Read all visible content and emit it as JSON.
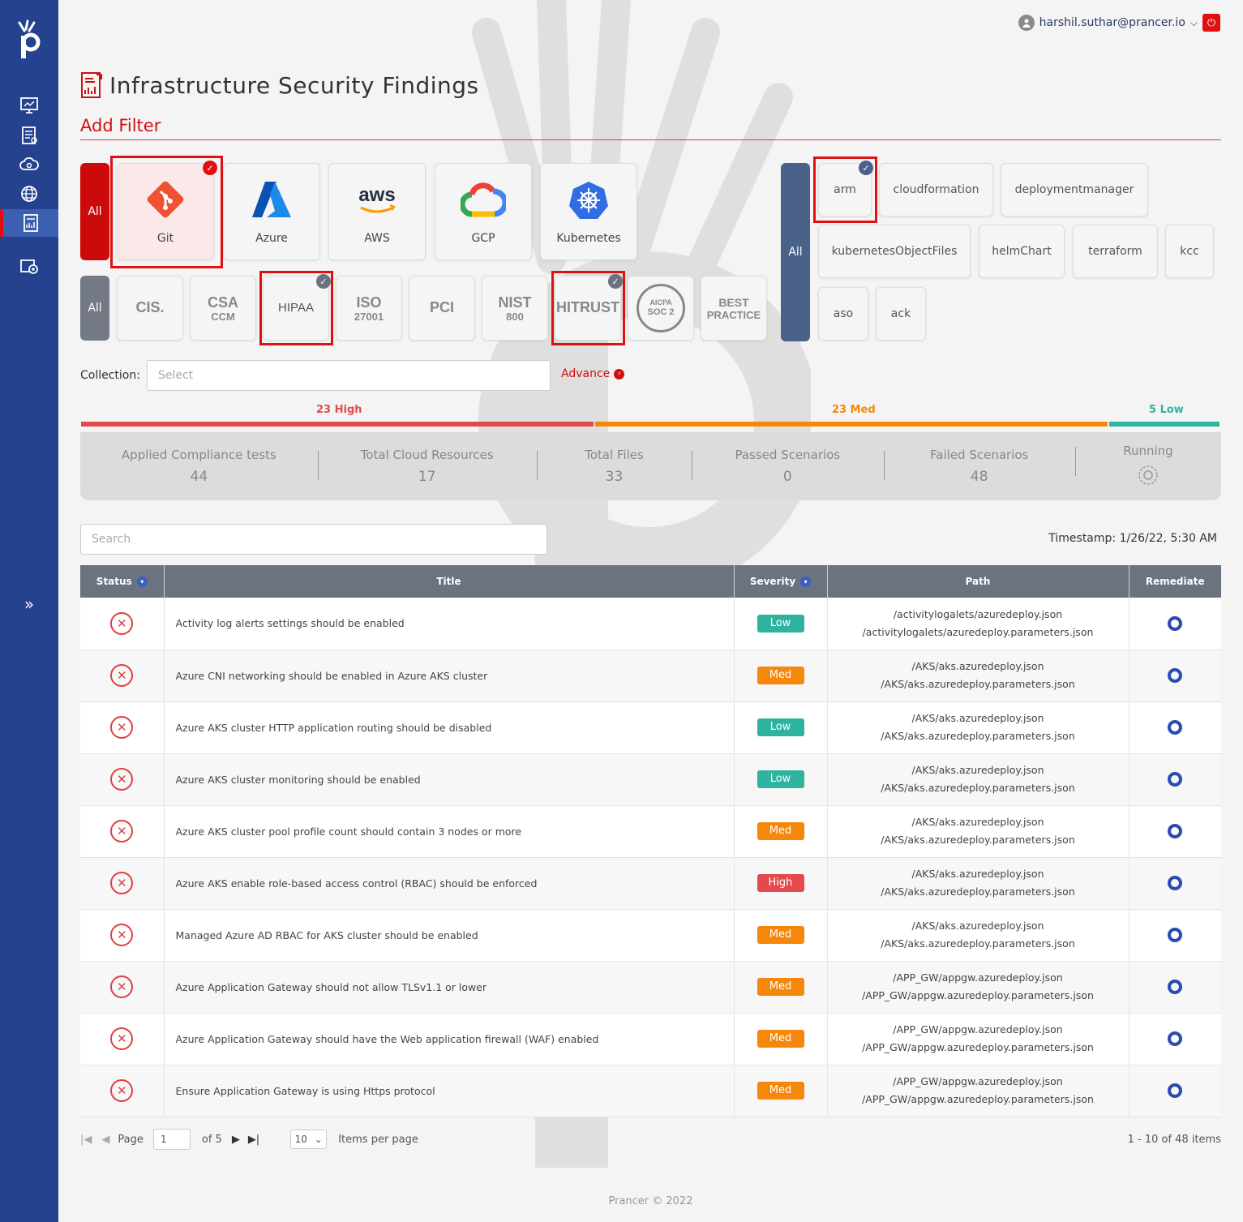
{
  "user": {
    "email": "harshil.suthar@prancer.io"
  },
  "page": {
    "title": "Infrastructure Security Findings",
    "add_filter": "Add Filter"
  },
  "filters": {
    "all_label": "All",
    "providers": [
      "Git",
      "Azure",
      "AWS",
      "GCP",
      "Kubernetes"
    ],
    "compliance": [
      {
        "name": "cis",
        "line1": "CIS.",
        "line2": ""
      },
      {
        "name": "csa-ccm",
        "line1": "CSA",
        "line2": "CCM"
      },
      {
        "name": "hipaa",
        "line1": "HIPAA",
        "line2": ""
      },
      {
        "name": "iso",
        "line1": "ISO",
        "line2": "27001"
      },
      {
        "name": "pci",
        "line1": "PCI",
        "line2": ""
      },
      {
        "name": "nist",
        "line1": "NIST",
        "line2": "800"
      },
      {
        "name": "hitrust",
        "line1": "HITRUST",
        "line2": ""
      },
      {
        "name": "soc2",
        "line1": "AICPA",
        "line2": "SOC 2"
      },
      {
        "name": "best-practice",
        "line1": "BEST",
        "line2": "PRACTICE"
      }
    ],
    "templates": [
      "arm",
      "cloudformation",
      "deploymentmanager",
      "kubernetesObjectFiles",
      "helmChart",
      "terraform",
      "kcc",
      "aso",
      "ack"
    ]
  },
  "collection": {
    "label": "Collection:",
    "placeholder": "Select"
  },
  "advance": "Advance",
  "severity": {
    "high": "23 High",
    "med": "23 Med",
    "low": "5 Low",
    "high_count": 23,
    "med_count": 23,
    "low_count": 5
  },
  "stats": [
    {
      "label": "Applied Compliance tests",
      "value": "44"
    },
    {
      "label": "Total Cloud Resources",
      "value": "17"
    },
    {
      "label": "Total Files",
      "value": "33"
    },
    {
      "label": "Passed Scenarios",
      "value": "0"
    },
    {
      "label": "Failed Scenarios",
      "value": "48"
    },
    {
      "label": "Running",
      "value": ""
    }
  ],
  "search": {
    "placeholder": "Search"
  },
  "timestamp": "Timestamp: 1/26/22, 5:30 AM",
  "table": {
    "headers": {
      "status": "Status",
      "title": "Title",
      "severity": "Severity",
      "path": "Path",
      "remediate": "Remediate"
    },
    "rows": [
      {
        "title": "Activity log alerts settings should be enabled",
        "severity": "Low",
        "path1": "/activitylogalets/azuredeploy.json",
        "path2": "/activitylogalets/azuredeploy.parameters.json"
      },
      {
        "title": "Azure CNI networking should be enabled in Azure AKS cluster",
        "severity": "Med",
        "path1": "/AKS/aks.azuredeploy.json",
        "path2": "/AKS/aks.azuredeploy.parameters.json"
      },
      {
        "title": "Azure AKS cluster HTTP application routing should be disabled",
        "severity": "Low",
        "path1": "/AKS/aks.azuredeploy.json",
        "path2": "/AKS/aks.azuredeploy.parameters.json"
      },
      {
        "title": "Azure AKS cluster monitoring should be enabled",
        "severity": "Low",
        "path1": "/AKS/aks.azuredeploy.json",
        "path2": "/AKS/aks.azuredeploy.parameters.json"
      },
      {
        "title": "Azure AKS cluster pool profile count should contain 3 nodes or more",
        "severity": "Med",
        "path1": "/AKS/aks.azuredeploy.json",
        "path2": "/AKS/aks.azuredeploy.parameters.json"
      },
      {
        "title": "Azure AKS enable role-based access control (RBAC) should be enforced",
        "severity": "High",
        "path1": "/AKS/aks.azuredeploy.json",
        "path2": "/AKS/aks.azuredeploy.parameters.json"
      },
      {
        "title": "Managed Azure AD RBAC for AKS cluster should be enabled",
        "severity": "Med",
        "path1": "/AKS/aks.azuredeploy.json",
        "path2": "/AKS/aks.azuredeploy.parameters.json"
      },
      {
        "title": "Azure Application Gateway should not allow TLSv1.1 or lower",
        "severity": "Med",
        "path1": "/APP_GW/appgw.azuredeploy.json",
        "path2": "/APP_GW/appgw.azuredeploy.parameters.json"
      },
      {
        "title": "Azure Application Gateway should have the Web application firewall (WAF) enabled",
        "severity": "Med",
        "path1": "/APP_GW/appgw.azuredeploy.json",
        "path2": "/APP_GW/appgw.azuredeploy.parameters.json"
      },
      {
        "title": "Ensure Application Gateway is using Https protocol",
        "severity": "Med",
        "path1": "/APP_GW/appgw.azuredeploy.json",
        "path2": "/APP_GW/appgw.azuredeploy.parameters.json"
      }
    ]
  },
  "pager": {
    "page_label": "Page",
    "page": "1",
    "of": "of 5",
    "per_page": "10",
    "items_label": "Items per page",
    "summary": "1 - 10 of 48 items"
  },
  "footer": "Prancer © 2022",
  "colors": {
    "sidebar": "#24428e",
    "accent": "#e01010",
    "high": "#e5484d",
    "med": "#f5870a",
    "low": "#2db39e",
    "template_all": "#4a6189",
    "compliance_all": "#737985"
  }
}
